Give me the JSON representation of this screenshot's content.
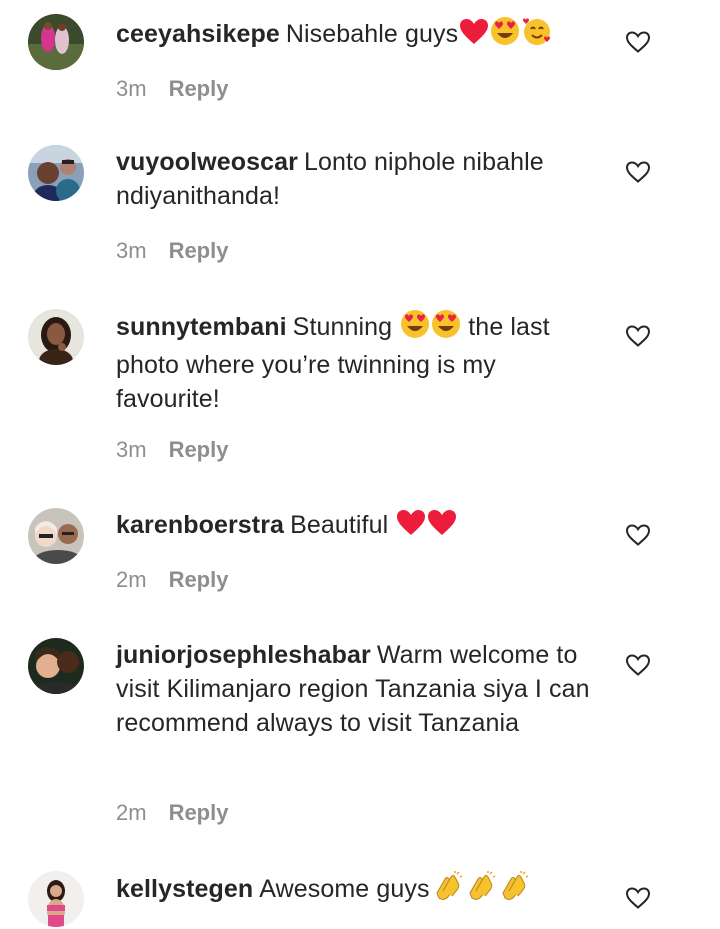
{
  "comments": [
    {
      "username": "ceeyahsikepe",
      "text": "Nisebahle guys",
      "emojis": [
        "heart",
        "heart-eyes",
        "smiling-hearts"
      ],
      "time": "3m",
      "reply": "Reply"
    },
    {
      "username": "vuyoolweoscar",
      "text": "Lonto niphole nibahle ndiyanithanda!",
      "emojis": [],
      "time": "3m",
      "reply": "Reply"
    },
    {
      "username": "sunnytembani",
      "text_before": "Stunning",
      "emojis": [
        "heart-eyes",
        "heart-eyes"
      ],
      "text": "the last photo where you’re twinning is my favourite!",
      "time": "3m",
      "reply": "Reply"
    },
    {
      "username": "karenboerstra",
      "text": "Beautiful",
      "emojis": [
        "heart",
        "heart"
      ],
      "time": "2m",
      "reply": "Reply"
    },
    {
      "username": "juniorjosephleshabar",
      "text": "Warm welcome to visit Kilimanjaro region Tanzania siya I can recommend always to visit Tanzania",
      "emojis": [],
      "time": "2m",
      "reply": "Reply"
    },
    {
      "username": "kellystegen",
      "text": "Awesome guys",
      "emojis": [
        "clap",
        "clap",
        "clap"
      ],
      "time": "",
      "reply": ""
    }
  ],
  "colors": {
    "text": "#262626",
    "meta": "#8e8e8e",
    "heart": "#ed1c3b",
    "emoji_face": "#f7c22a"
  }
}
